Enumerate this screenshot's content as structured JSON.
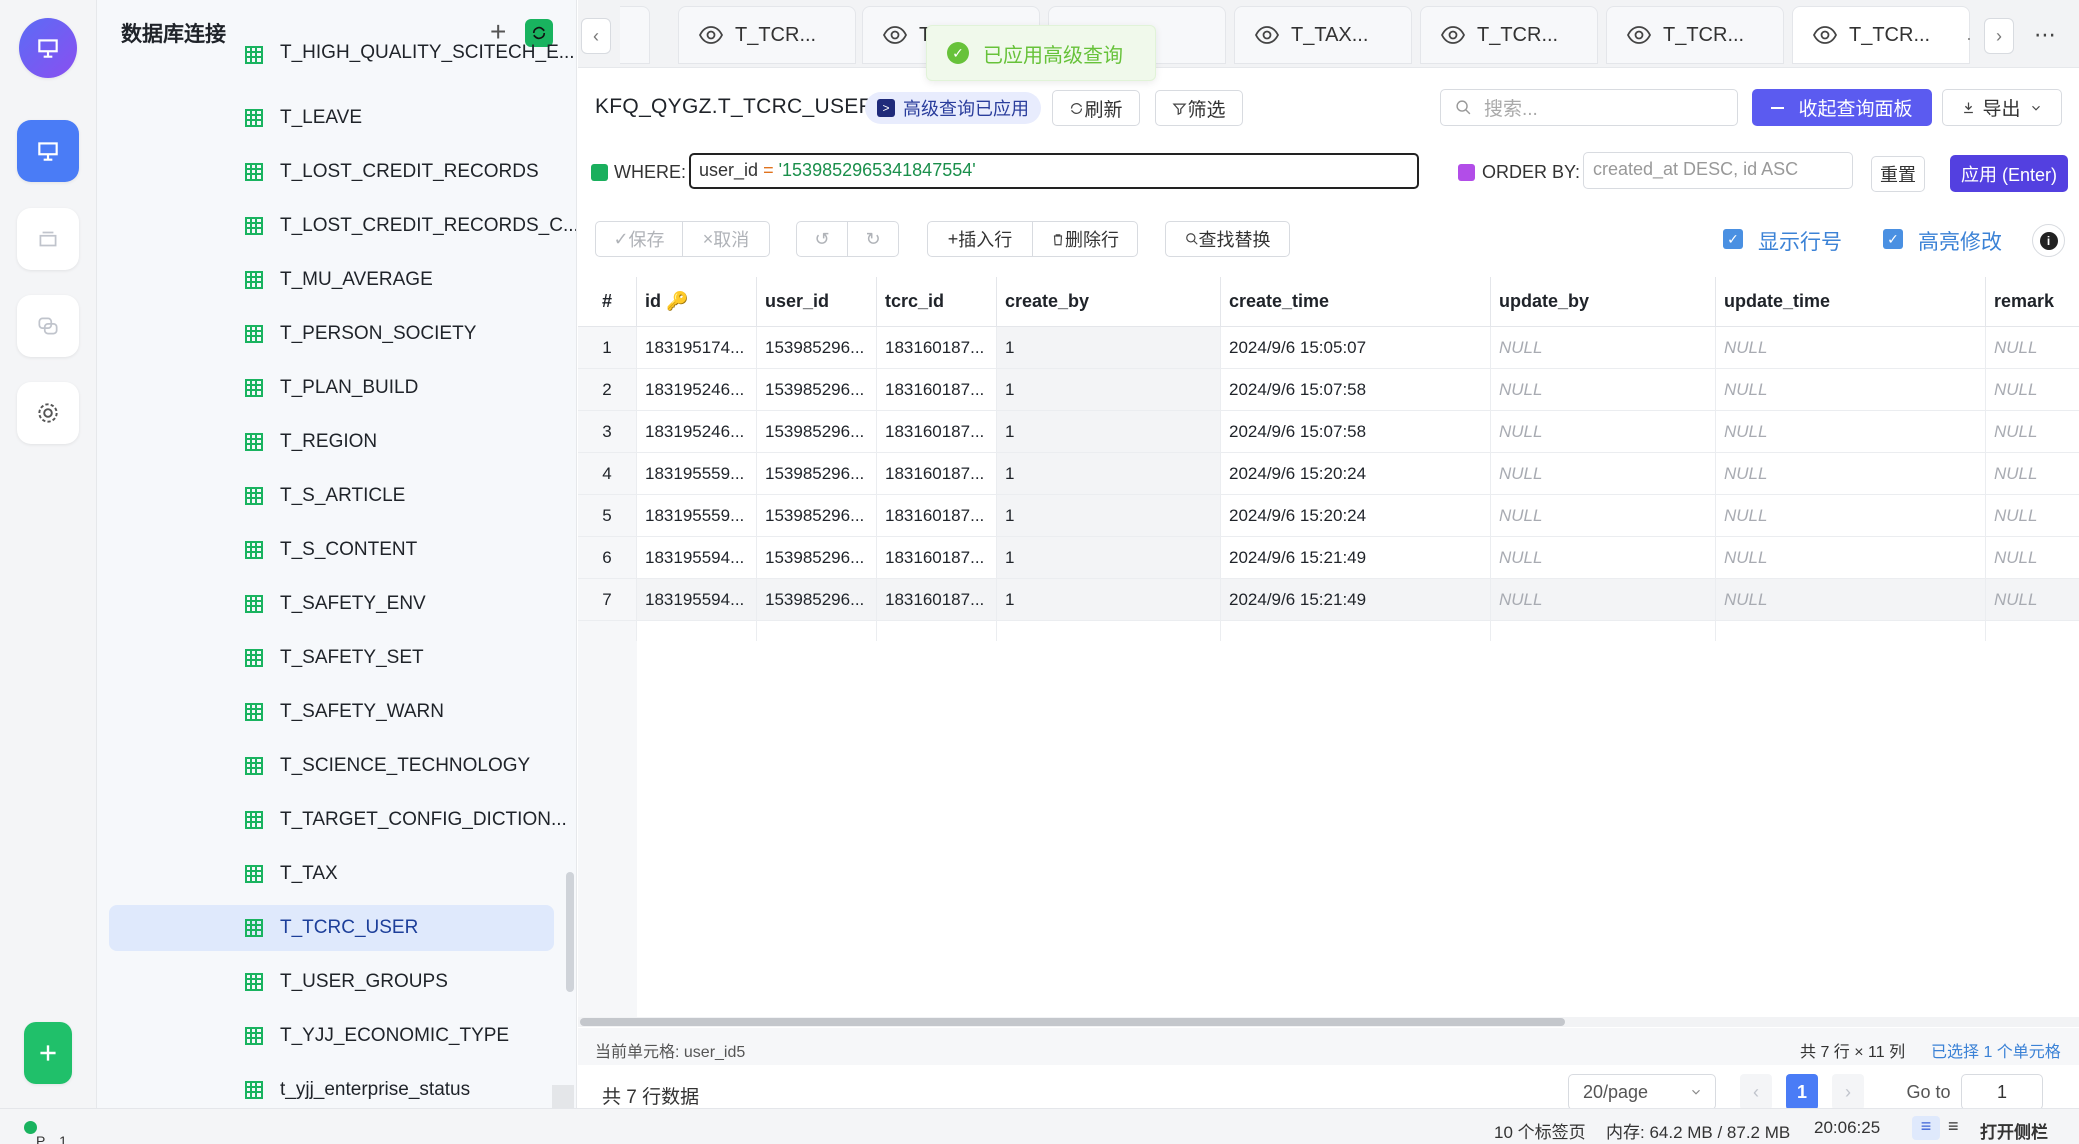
{
  "rail": {
    "items": [
      "logo",
      "explorer",
      "layers",
      "chat",
      "settings"
    ]
  },
  "tree": {
    "title": "数据库连接",
    "items": [
      {
        "label": "T_HIGH_QUALITY_SCITECH_E..."
      },
      {
        "label": "T_LEAVE"
      },
      {
        "label": "T_LOST_CREDIT_RECORDS"
      },
      {
        "label": "T_LOST_CREDIT_RECORDS_C..."
      },
      {
        "label": "T_MU_AVERAGE"
      },
      {
        "label": "T_PERSON_SOCIETY"
      },
      {
        "label": "T_PLAN_BUILD"
      },
      {
        "label": "T_REGION"
      },
      {
        "label": "T_S_ARTICLE"
      },
      {
        "label": "T_S_CONTENT"
      },
      {
        "label": "T_SAFETY_ENV"
      },
      {
        "label": "T_SAFETY_SET"
      },
      {
        "label": "T_SAFETY_WARN"
      },
      {
        "label": "T_SCIENCE_TECHNOLOGY"
      },
      {
        "label": "T_TARGET_CONFIG_DICTION..."
      },
      {
        "label": "T_TAX"
      },
      {
        "label": "T_TCRC_USER",
        "selected": true
      },
      {
        "label": "T_USER_GROUPS"
      },
      {
        "label": "T_YJJ_ECONOMIC_TYPE"
      },
      {
        "label": "t_yjj_enterprise_status"
      }
    ]
  },
  "tabs": [
    {
      "label": "T_TCR..."
    },
    {
      "label": "T..."
    },
    {
      "label": "..."
    },
    {
      "label": "T_TAX..."
    },
    {
      "label": "T_TCR..."
    },
    {
      "label": "T_TCR..."
    },
    {
      "label": "T_TCR...",
      "active": true
    }
  ],
  "tab_more": "·",
  "toast": {
    "text": "已应用高级查询"
  },
  "header": {
    "table_name": "KFQ_QYGZ.T_TCRC_USER",
    "badge": "高级查询已应用",
    "refresh": "刷新",
    "filter": "筛选",
    "search_placeholder": "搜索...",
    "collapse": "收起查询面板",
    "export": "导出"
  },
  "query": {
    "where_label": "WHERE:",
    "where_field": "user_id",
    "where_op": "=",
    "where_value": "'1539852965341847554'",
    "orderby_label": "ORDER BY:",
    "orderby_placeholder": "created_at DESC, id ASC",
    "reset": "重置",
    "apply": "应用 (Enter)"
  },
  "toolbar": {
    "save": "保存",
    "cancel": "取消",
    "insert_row": "插入行",
    "delete_row": "删除行",
    "find_replace": "查找替换",
    "show_row_numbers": "显示行号",
    "highlight_changes": "高亮修改"
  },
  "grid": {
    "columns": [
      "#",
      "id",
      "user_id",
      "tcrc_id",
      "create_by",
      "create_time",
      "update_by",
      "update_time",
      "remark"
    ],
    "rows": [
      [
        "1",
        "183195174...",
        "153985296...",
        "183160187...",
        "1",
        "2024/9/6 15:05:07",
        "NULL",
        "NULL",
        "NULL"
      ],
      [
        "2",
        "183195246...",
        "153985296...",
        "183160187...",
        "1",
        "2024/9/6 15:07:58",
        "NULL",
        "NULL",
        "NULL"
      ],
      [
        "3",
        "183195246...",
        "153985296...",
        "183160187...",
        "1",
        "2024/9/6 15:07:58",
        "NULL",
        "NULL",
        "NULL"
      ],
      [
        "4",
        "183195559...",
        "153985296...",
        "183160187...",
        "1",
        "2024/9/6 15:20:24",
        "NULL",
        "NULL",
        "NULL"
      ],
      [
        "5",
        "183195559...",
        "153985296...",
        "183160187...",
        "1",
        "2024/9/6 15:20:24",
        "NULL",
        "NULL",
        "NULL"
      ],
      [
        "6",
        "183195594...",
        "153985296...",
        "183160187...",
        "1",
        "2024/9/6 15:21:49",
        "NULL",
        "NULL",
        "NULL"
      ],
      [
        "7",
        "183195594...",
        "153985296...",
        "183160187...",
        "1",
        "2024/9/6 15:21:49",
        "NULL",
        "NULL",
        "NULL"
      ]
    ]
  },
  "status": {
    "current_cell": "当前单元格: user_id5",
    "dims": "共 7 行 × 11 列",
    "selected": "已选择 1 个单元格",
    "total": "共 7 行数据",
    "page_size": "20/page",
    "page": "1",
    "goto_label": "Go to",
    "goto_value": "1"
  },
  "footer": {
    "left": "P... 1",
    "tabs_count": "10 个标签页",
    "memory": "内存: 64.2 MB / 87.2 MB",
    "time": "20:06:25",
    "sidebar": "打开侧栏"
  },
  "colors": {
    "accent": "#5b5bf0",
    "apply": "#5340e0",
    "success": "#19b35f",
    "link": "#3b82d6"
  }
}
